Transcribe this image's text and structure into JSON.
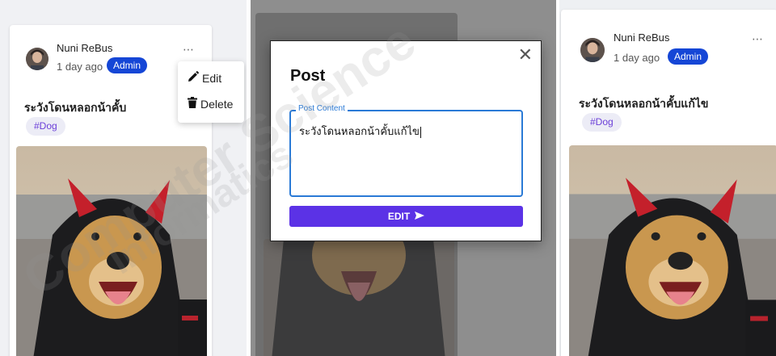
{
  "post": {
    "author": "Nuni ReBus",
    "time_ago": "1 day ago",
    "role_badge": "Admin",
    "title_original": "ระวังโดนหลอกน้าคั้บ",
    "title_edited": "ระวังโดนหลอกน้าคั้บแก้ไข",
    "tag": "#Dog",
    "more_icon": "⋯"
  },
  "menu": {
    "edit_label": "Edit",
    "delete_label": "Delete",
    "edit_icon": "pencil-icon",
    "delete_icon": "trash-icon"
  },
  "modal": {
    "title": "Post",
    "close_icon": "✕",
    "field_label": "Post Content",
    "field_value": "ระวังโดนหลอกน้าคั้บแก้ไข",
    "submit_label": "EDIT",
    "submit_icon": "send-icon"
  },
  "watermark": {
    "line1": "Computer Science",
    "line2": "Informatics"
  },
  "colors": {
    "badge": "#1546d6",
    "submit": "#5b32e6",
    "field_border": "#2a7ad6",
    "tag_text": "#6b3fd8"
  }
}
